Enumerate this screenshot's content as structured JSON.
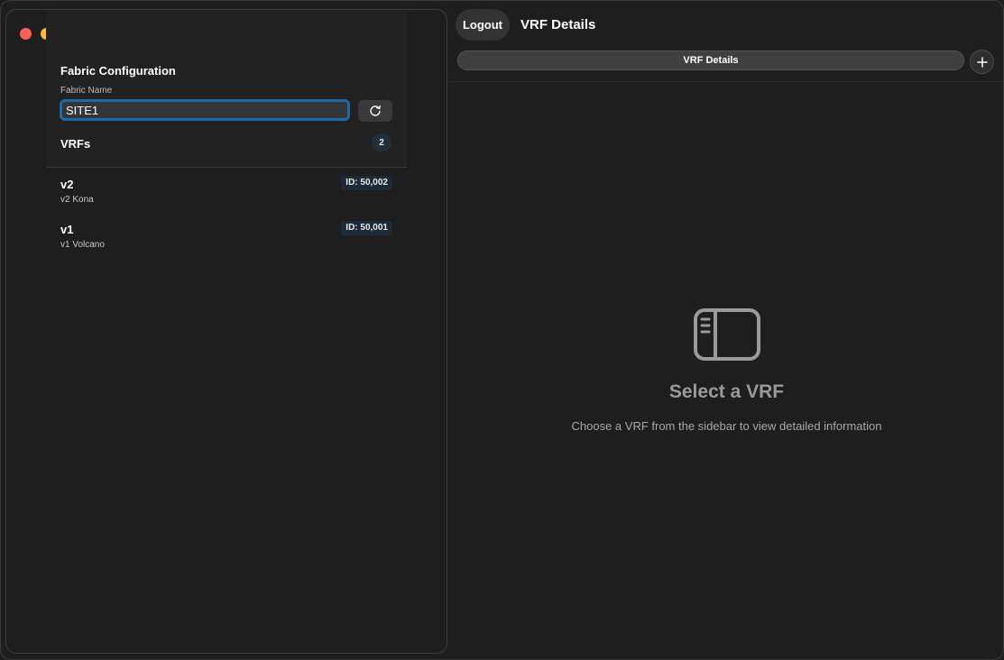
{
  "toolbar": {
    "logout_label": "Logout",
    "window_title": "VRF Details"
  },
  "tabs": [
    {
      "label": "VRF Details"
    }
  ],
  "sidebar": {
    "section_title": "Fabric Configuration",
    "fabric_field_label": "Fabric Name",
    "fabric_name_value": "SITE1",
    "vrfs_title": "VRFs",
    "vrf_count": "2",
    "vrfs": [
      {
        "name": "v2",
        "description": "v2 Kona",
        "id_label": "ID: 50,002"
      },
      {
        "name": "v1",
        "description": "v1 Volcano",
        "id_label": "ID: 50,001"
      }
    ]
  },
  "empty_state": {
    "title": "Select a VRF",
    "subtitle": "Choose a VRF from the sidebar to view detailed information",
    "icon": "sidebar-icon"
  },
  "colors": {
    "background": "#1e1e1e",
    "focus_ring": "#1d6aa5",
    "badge_bg": "#1c2b37",
    "traffic_red": "#fe5f57",
    "traffic_yellow": "#febc2e",
    "traffic_green": "#28c840"
  }
}
